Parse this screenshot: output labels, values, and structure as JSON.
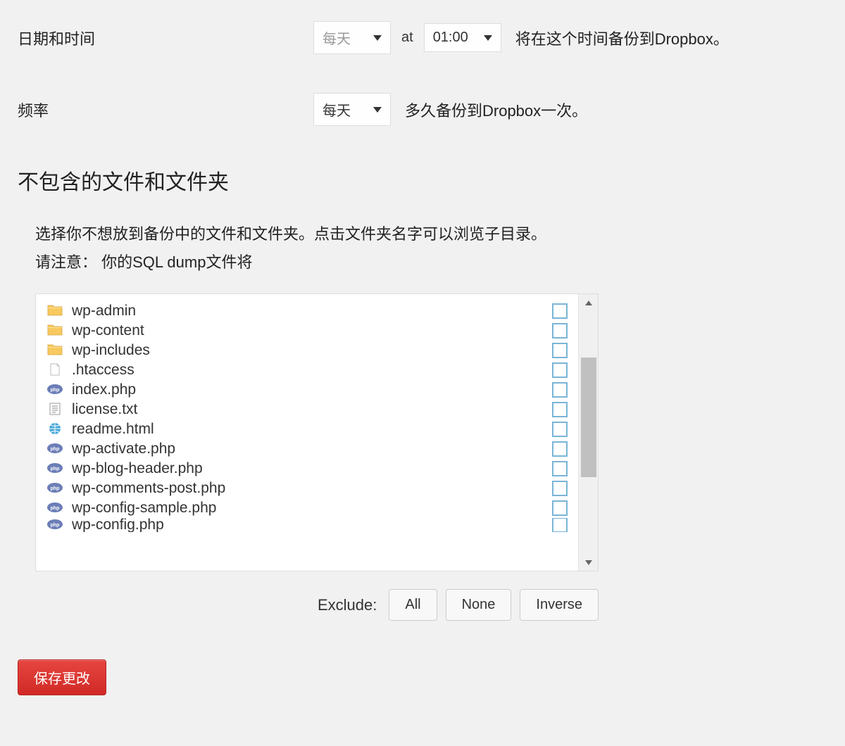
{
  "datetime": {
    "label": "日期和时间",
    "period_value": "每天",
    "at": "at",
    "time_value": "01:00",
    "desc": "将在这个时间备份到Dropbox。"
  },
  "frequency": {
    "label": "频率",
    "value": "每天",
    "desc": "多久备份到Dropbox一次。"
  },
  "exclude_section": {
    "heading": "不包含的文件和文件夹",
    "desc_line1": "选择你不想放到备份中的文件和文件夹。点击文件夹名字可以浏览子目录。",
    "desc_line2": "请注意： 你的SQL dump文件将"
  },
  "files": [
    {
      "name": "wp-admin",
      "type": "folder"
    },
    {
      "name": "wp-content",
      "type": "folder"
    },
    {
      "name": "wp-includes",
      "type": "folder"
    },
    {
      "name": ".htaccess",
      "type": "file"
    },
    {
      "name": "index.php",
      "type": "php"
    },
    {
      "name": "license.txt",
      "type": "text"
    },
    {
      "name": "readme.html",
      "type": "html"
    },
    {
      "name": "wp-activate.php",
      "type": "php"
    },
    {
      "name": "wp-blog-header.php",
      "type": "php"
    },
    {
      "name": "wp-comments-post.php",
      "type": "php"
    },
    {
      "name": "wp-config-sample.php",
      "type": "php"
    },
    {
      "name": "wp-config.php",
      "type": "php"
    }
  ],
  "exclude_bar": {
    "label": "Exclude:",
    "all": "All",
    "none": "None",
    "inverse": "Inverse"
  },
  "save_button": "保存更改"
}
